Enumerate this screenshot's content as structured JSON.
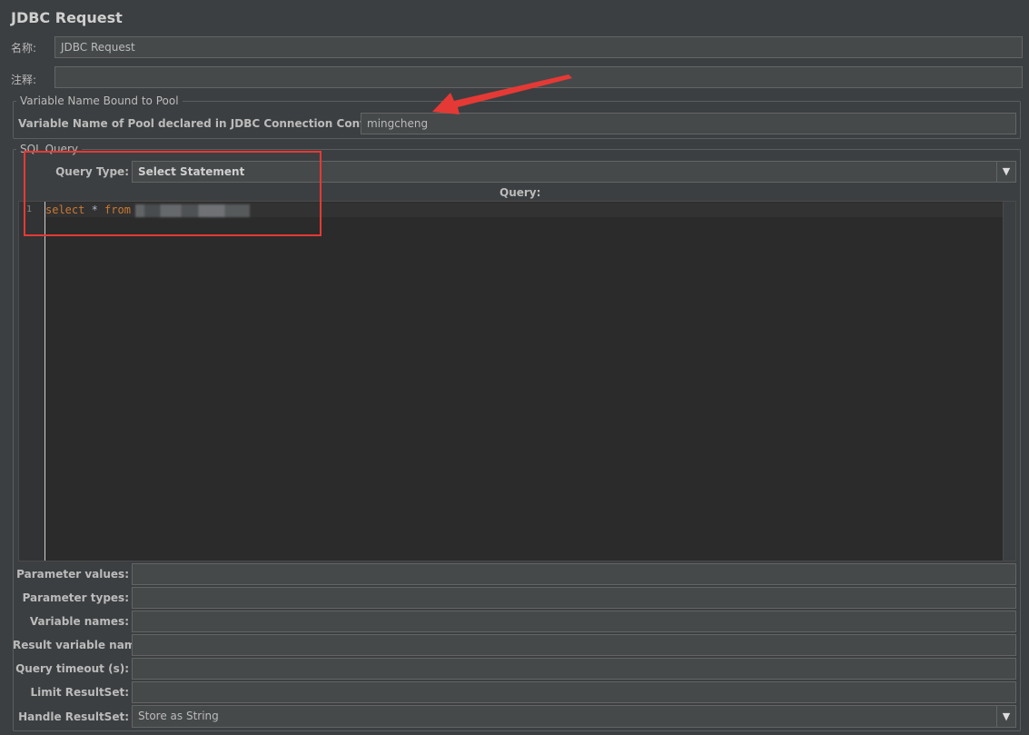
{
  "window": {
    "title": "JDBC Request"
  },
  "name_field": {
    "label": "名称:",
    "value": "JDBC Request"
  },
  "comment_field": {
    "label": "注释:",
    "value": ""
  },
  "pool_group": {
    "title": "Variable Name Bound to Pool",
    "label": "Variable Name of Pool declared in JDBC Connection Configuration:",
    "value": "mingcheng"
  },
  "sql_group": {
    "title": "SQL Query",
    "query_type_label": "Query Type:",
    "query_type_value": "Select Statement",
    "query_label": "Query:",
    "editor": {
      "line_number": "1",
      "kw_select": "select",
      "star": " * ",
      "kw_from": "from"
    }
  },
  "params": {
    "parameter_values": {
      "label": "Parameter values:",
      "value": ""
    },
    "parameter_types": {
      "label": "Parameter types:",
      "value": ""
    },
    "variable_names": {
      "label": "Variable names:",
      "value": ""
    },
    "result_variable_name": {
      "label": "Result variable name:",
      "value": ""
    },
    "query_timeout": {
      "label": "Query timeout (s):",
      "value": ""
    },
    "limit_resultset": {
      "label": "Limit ResultSet:",
      "value": ""
    },
    "handle_resultset": {
      "label": "Handle ResultSet:",
      "value": "Store as String"
    }
  },
  "icons": {
    "dropdown": "▼",
    "annotation_arrow": "red-arrow-icon"
  },
  "colors": {
    "accent_red": "#e53935",
    "keyword": "#cc7832",
    "background": "#3c3f41"
  }
}
